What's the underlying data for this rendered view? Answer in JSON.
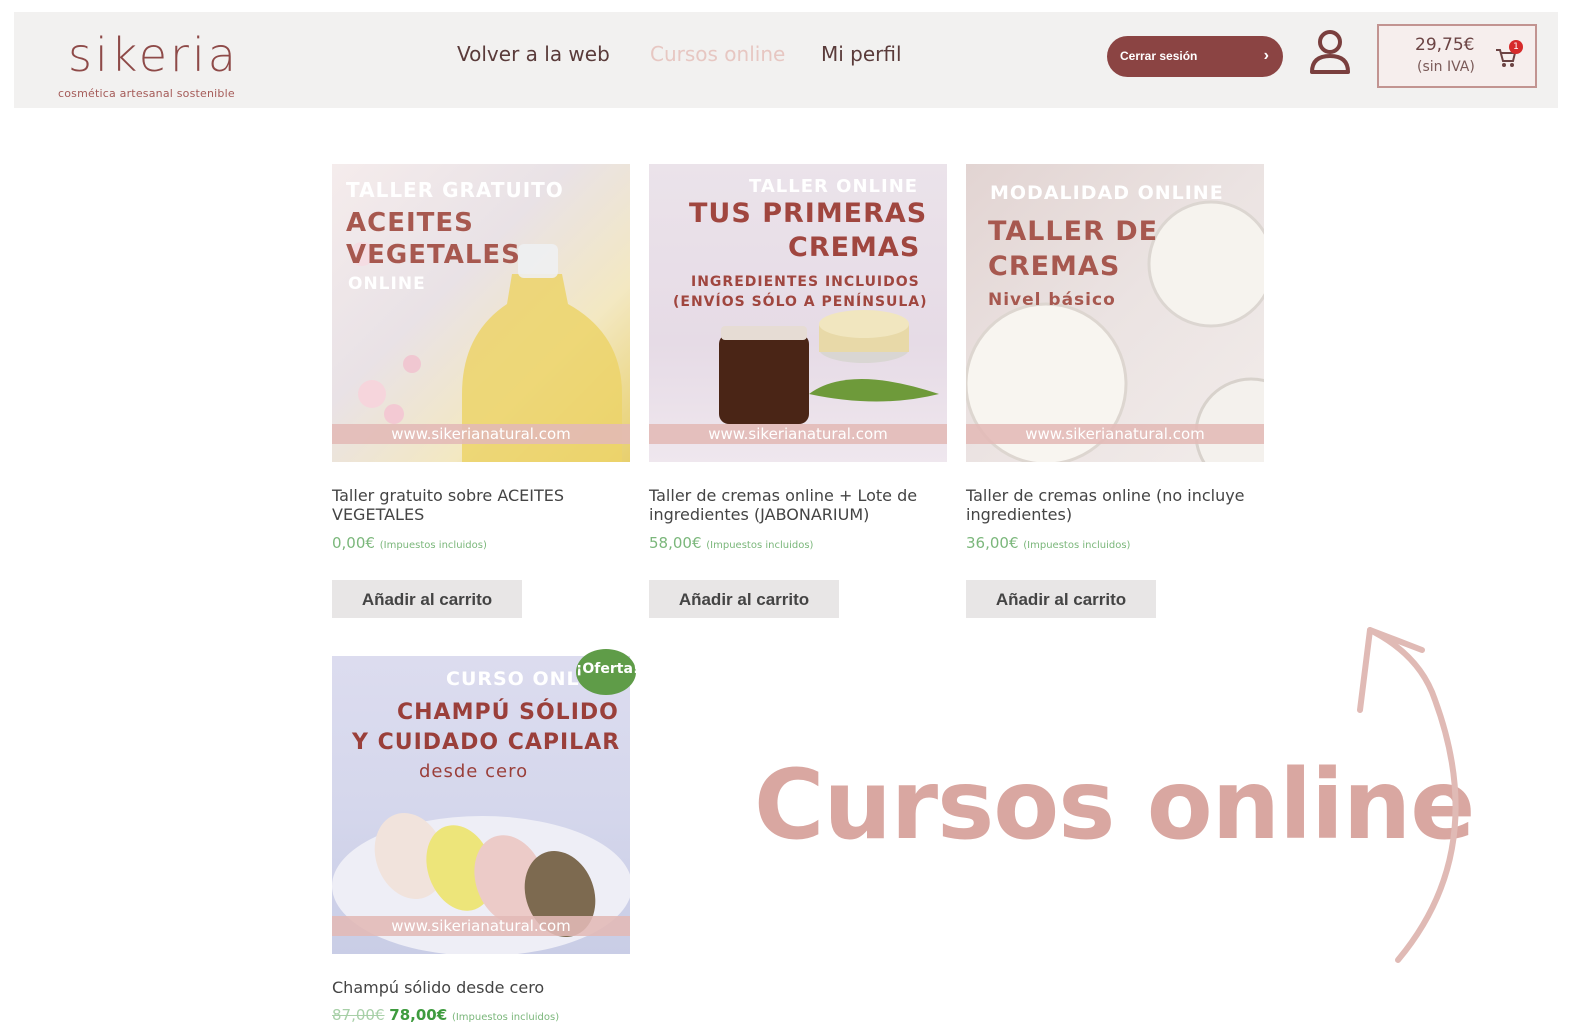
{
  "header": {
    "logo": {
      "word": "sikeria",
      "tagline": "cosmética artesanal sostenible"
    },
    "nav": [
      {
        "label": "Volver a la web"
      },
      {
        "label": "Cursos online"
      },
      {
        "label": "Mi perfil"
      }
    ],
    "logout_label": "Cerrar sesión",
    "cart": {
      "amount": "29,75€",
      "tax_note": "(sin IVA)",
      "count": "1"
    }
  },
  "products": [
    {
      "image_lines": [
        "TALLER GRATUITO",
        "ACEITES",
        "VEGETALES",
        "ONLINE"
      ],
      "image_site": "www.sikerianatural.com",
      "title": "Taller gratuito sobre ACEITES VEGETALES",
      "price": "0,00€",
      "tax": "(Impuestos incluidos)",
      "button": "Añadir al carrito"
    },
    {
      "image_lines": [
        "TALLER ONLINE",
        "TUS PRIMERAS",
        "CREMAS",
        "INGREDIENTES INCLUIDOS",
        "(ENVÍOS SÓLO A PENÍNSULA)"
      ],
      "image_site": "www.sikerianatural.com",
      "title": "Taller de cremas online + Lote de ingredientes (JABONARIUM)",
      "price": "58,00€",
      "tax": "(Impuestos incluidos)",
      "button": "Añadir al carrito"
    },
    {
      "image_lines": [
        "MODALIDAD ONLINE",
        "TALLER DE",
        "CREMAS",
        "Nivel básico"
      ],
      "image_site": "www.sikerianatural.com",
      "title": "Taller de cremas online (no incluye ingredientes)",
      "price": "36,00€",
      "tax": "(Impuestos incluidos)",
      "button": "Añadir al carrito"
    },
    {
      "image_lines": [
        "CURSO ONLINE",
        "CHAMPÚ SÓLIDO",
        "Y CUIDADO CAPILAR",
        "desde cero"
      ],
      "image_site": "www.sikerianatural.com",
      "badge": "¡Oferta!",
      "title": "Champú sólido desde cero",
      "old_price": "87,00€",
      "price": "78,00€",
      "tax": "(Impuestos incluidos)"
    }
  ],
  "overlay_title": "Cursos online",
  "colors": {
    "brand": "#8b4443",
    "accent": "#d9a7a1",
    "price": "#7bb77b",
    "offer": "#5f9c48"
  }
}
